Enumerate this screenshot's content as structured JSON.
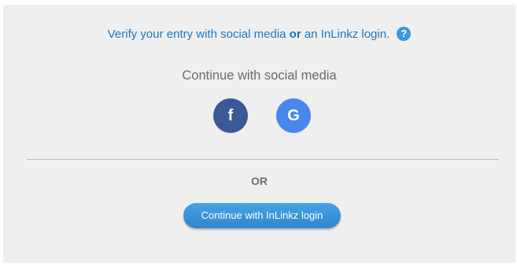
{
  "verify": {
    "text_before": "Verify your entry with social media ",
    "text_or": "or",
    "text_after": " an InLinkz login.",
    "help_glyph": "?",
    "help_icon": "question-circle-icon"
  },
  "social": {
    "heading": "Continue with social media",
    "facebook": {
      "glyph": "f",
      "icon": "facebook-icon",
      "color": "#3b5998"
    },
    "google": {
      "glyph": "G",
      "icon": "google-icon",
      "color": "#4a87ec"
    }
  },
  "separator": {
    "or_label": "OR"
  },
  "login": {
    "button_label": "Continue with InLinkz login",
    "color": "#3a96dc"
  }
}
